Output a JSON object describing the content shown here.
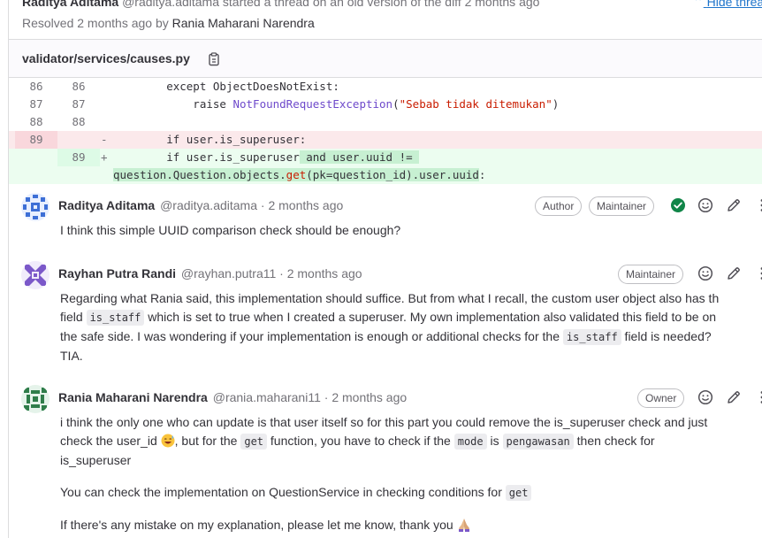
{
  "thread": {
    "author": "Raditya Aditama",
    "header_rest": "@raditya.aditama started a thread on an old version of the diff 2 months ago",
    "resolved_prefix": "Resolved 2 months ago by",
    "resolved_by": "Rania Maharani Narendra",
    "hide_label": "Hide thread"
  },
  "file": {
    "name": "validator/services/causes.py"
  },
  "diff": [
    {
      "old": "86",
      "new": "86",
      "sign": "",
      "type": "context"
    },
    {
      "old": "87",
      "new": "87",
      "sign": "",
      "type": "context"
    },
    {
      "old": "88",
      "new": "88",
      "sign": "",
      "type": "context"
    },
    {
      "old": "89",
      "new": "",
      "sign": "-",
      "type": "removed"
    },
    {
      "old": "",
      "new": "89",
      "sign": "+",
      "type": "added"
    }
  ],
  "code": {
    "l86_a": "        except ",
    "l86_b": "ObjectDoesNotExist:",
    "l87_a": "            raise ",
    "l87_b": "NotFoundRequestException",
    "l87_c": "(",
    "l87_d": "\"Sebab tidak ditemukan\"",
    "l87_e": ")",
    "l89_removed": "        if user.is_superuser:",
    "l89_added_a": "        if user.is_superuser",
    "l89_added_b": " and user.uuid != ",
    "l89_cont_a": "question.Question.objects.",
    "l89_cont_b": "get",
    "l89_cont_c": "(pk=question_id).user.uuid",
    "l89_cont_d": ":"
  },
  "notes": [
    {
      "name": "Raditya Aditama",
      "handle": "@raditya.aditama",
      "time": "· 2 months ago",
      "badges": [
        "Author",
        "Maintainer"
      ],
      "body": "I think this simple UUID comparison check should be enough?"
    },
    {
      "name": "Rayhan Putra Randi",
      "handle": "@rayhan.putra11",
      "time": "· 2 months ago",
      "badges": [
        "Maintainer"
      ],
      "p1_a": "Regarding what Rania said, this implementation should suffice. But from what I recall, the custom user object also has th",
      "p1_b": "field ",
      "p1_code1": "is_staff",
      "p1_c": " which is set to true when I created a superuser. My own implementation also validated this field to be on",
      "p1_d": "the safe side. I was wondering if your implementation is enough or additional checks for the ",
      "p1_code2": "is_staff",
      "p1_e": " field is needed?",
      "p1_f": "TIA."
    },
    {
      "name": "Rania Maharani Narendra",
      "handle": "@rania.maharani11",
      "time": "· 2 months ago",
      "badges": [
        "Owner"
      ],
      "p1_a": "i think the only one who can update is that user itself so for this part you could remove the is_superuser check and just",
      "p1_b": "check the user_id ",
      "p1_c": ", but for the ",
      "p1_code1": "get",
      "p1_d": " function, you have to check if the ",
      "p1_code2": "mode",
      "p1_e": " is ",
      "p1_code3": "pengawasan",
      "p1_f": " then check for",
      "p1_g": "is_superuser",
      "p2_a": "You can check the implementation on QuestionService in checking conditions for ",
      "p2_code": "get",
      "p3": "If there's any mistake on my explanation, please let me know, thank you "
    }
  ],
  "icons": {
    "resolved": "check-circle-icon",
    "emoji": "smile-icon",
    "edit": "pencil-icon",
    "more": "more-vertical-icon",
    "copy": "copy-to-clipboard-icon"
  },
  "colors": {
    "link": "#1f75cb",
    "resolved": "#108548",
    "removed_bg": "#fbe9eb",
    "added_bg": "#ecfdf0"
  }
}
